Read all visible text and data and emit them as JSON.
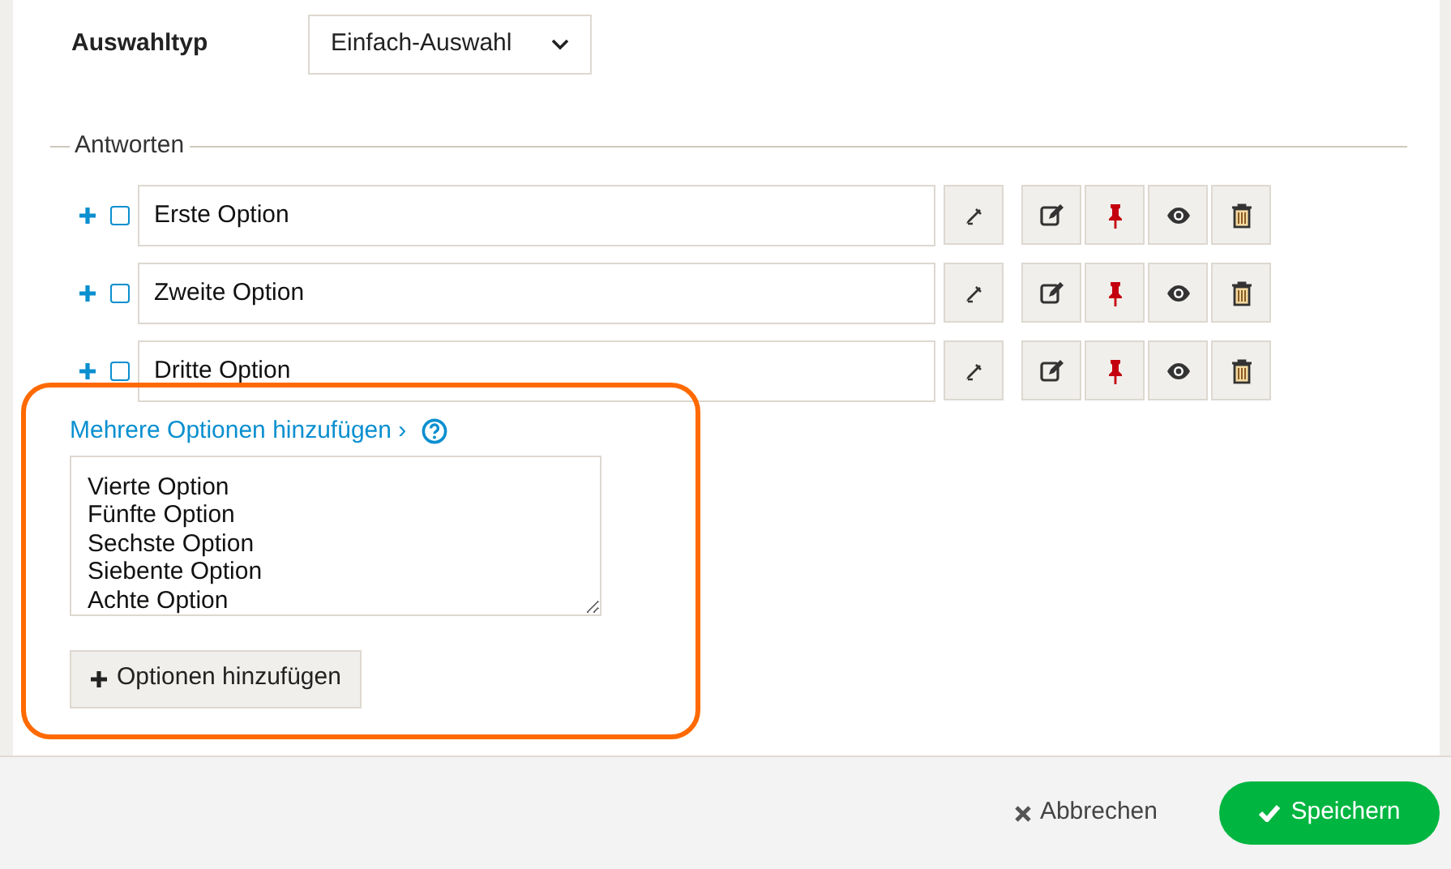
{
  "selection_type": {
    "label": "Auswahltyp",
    "value": "Einfach-Auswahl"
  },
  "answers": {
    "legend": "Antworten",
    "rows": [
      {
        "value": "Erste Option",
        "checked": false
      },
      {
        "value": "Zweite Option",
        "checked": false
      },
      {
        "value": "Dritte Option",
        "checked": false
      }
    ]
  },
  "bulk_add": {
    "link": "Mehrere Optionen hinzufügen ›",
    "lines": [
      "Vierte Option",
      "Fünfte Option",
      "Sechste Option",
      "Siebente Option",
      "Achte Option"
    ],
    "button": "Optionen hinzufügen"
  },
  "footer": {
    "cancel": "Abbrechen",
    "save": "Speichern"
  }
}
